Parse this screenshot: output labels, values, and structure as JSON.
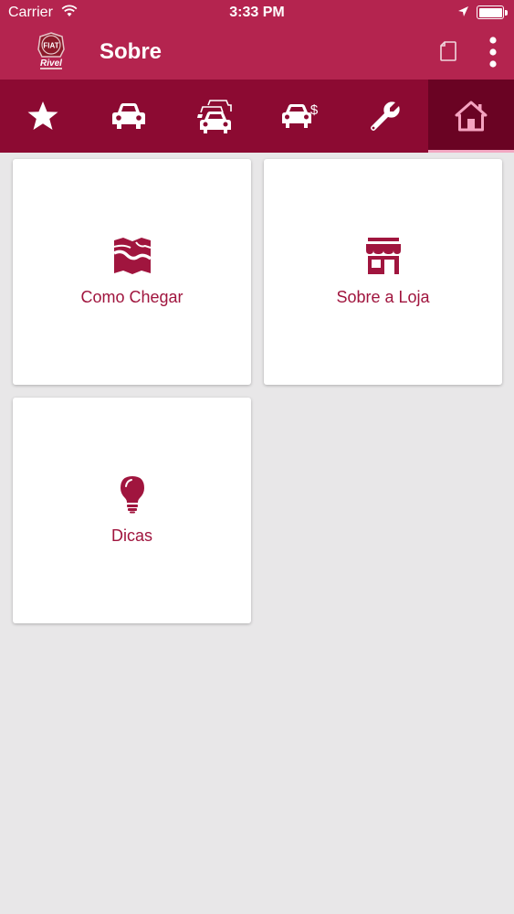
{
  "status_bar": {
    "carrier": "Carrier",
    "time": "3:33 PM"
  },
  "nav": {
    "title": "Sobre",
    "logo_text": "FIAT",
    "logo_sub": "Rivel"
  },
  "tabs": [
    {
      "icon": "star-icon",
      "active": false
    },
    {
      "icon": "car-icon",
      "active": false
    },
    {
      "icon": "cars-multiple-icon",
      "active": false
    },
    {
      "icon": "car-dollar-icon",
      "active": false
    },
    {
      "icon": "wrench-icon",
      "active": false
    },
    {
      "icon": "home-icon",
      "active": true
    }
  ],
  "cards": [
    {
      "label": "Como Chegar",
      "icon": "map-icon"
    },
    {
      "label": "Sobre a Loja",
      "icon": "store-icon"
    },
    {
      "label": "Dicas",
      "icon": "lightbulb-icon"
    }
  ],
  "colors": {
    "header": "#b4244f",
    "tabbar": "#8c0a32",
    "tab_active": "#6a0323",
    "accent": "#a0153e",
    "background": "#e8e7e8"
  }
}
